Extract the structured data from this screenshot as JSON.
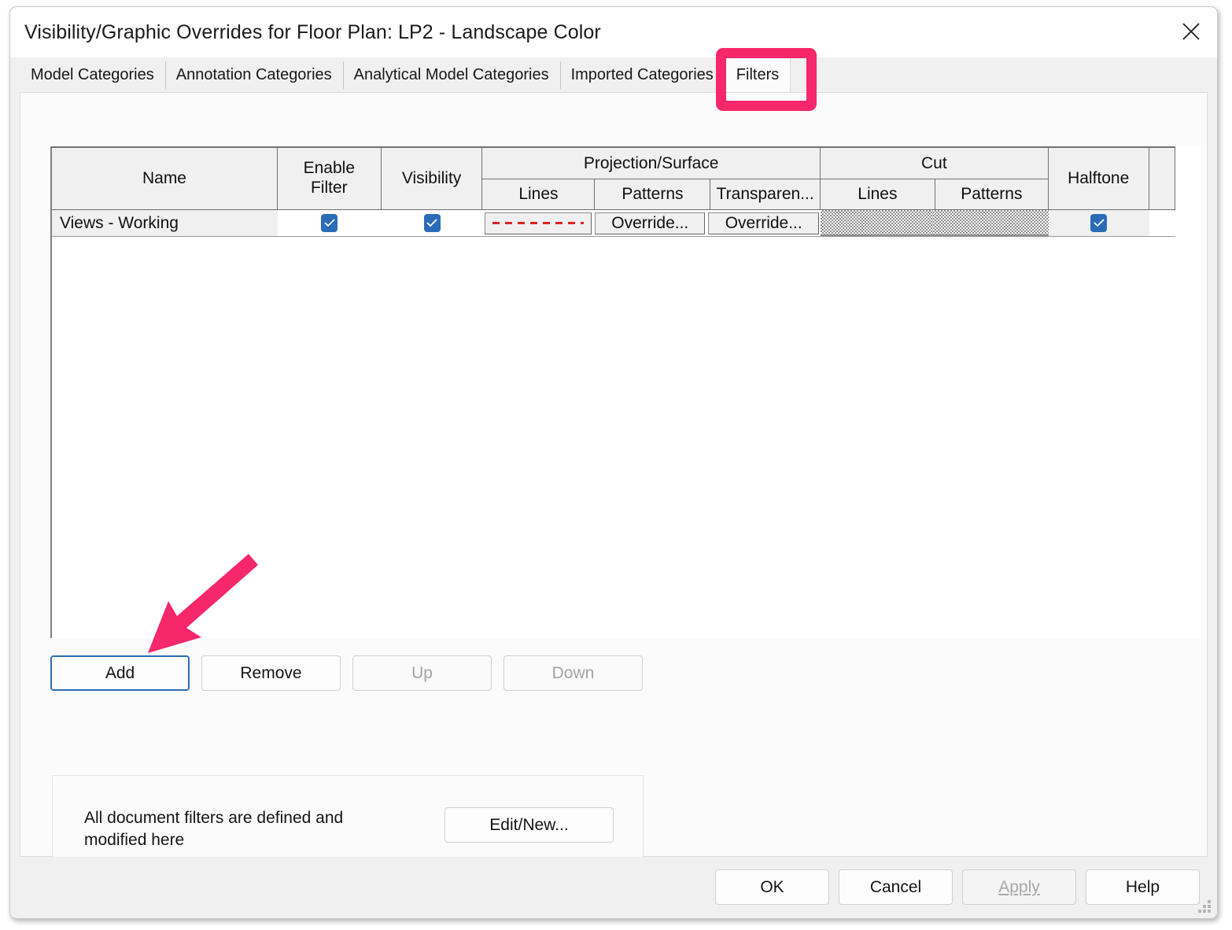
{
  "window": {
    "title": "Visibility/Graphic Overrides for Floor Plan: LP2 - Landscape Color",
    "close_icon": "close-icon"
  },
  "tabs": [
    {
      "label": "Model Categories",
      "selected": false
    },
    {
      "label": "Annotation Categories",
      "selected": false
    },
    {
      "label": "Analytical Model Categories",
      "selected": false
    },
    {
      "label": "Imported Categories",
      "selected": false
    },
    {
      "label": "Filters",
      "selected": true
    }
  ],
  "table": {
    "headers": {
      "name": "Name",
      "enable_filter_line1": "Enable",
      "enable_filter_line2": "Filter",
      "visibility": "Visibility",
      "projection_surface": "Projection/Surface",
      "projection_lines": "Lines",
      "projection_patterns": "Patterns",
      "projection_transparency": "Transparen...",
      "cut": "Cut",
      "cut_lines": "Lines",
      "cut_patterns": "Patterns",
      "halftone": "Halftone"
    },
    "rows": [
      {
        "name": "Views - Working",
        "enable_filter_checked": true,
        "visibility_checked": true,
        "projection_lines": "",
        "projection_lines_style": "red-dashed",
        "projection_patterns": "Override...",
        "projection_transparency": "Override...",
        "cut_lines": "",
        "cut_lines_disabled": true,
        "cut_patterns": "",
        "cut_patterns_disabled": true,
        "halftone_checked": true
      }
    ]
  },
  "list_buttons": [
    {
      "label": "Add",
      "enabled": true,
      "focused": true
    },
    {
      "label": "Remove",
      "enabled": true,
      "focused": false
    },
    {
      "label": "Up",
      "enabled": false,
      "focused": false
    },
    {
      "label": "Down",
      "enabled": false,
      "focused": false
    }
  ],
  "info_group": {
    "text": "All document filters are defined and modified here",
    "button_label": "Edit/New..."
  },
  "footer_buttons": [
    {
      "label": "OK",
      "enabled": true
    },
    {
      "label": "Cancel",
      "enabled": true
    },
    {
      "label": "Apply",
      "enabled": false,
      "accel": "A"
    },
    {
      "label": "Help",
      "enabled": true
    }
  ],
  "annotations": {
    "highlight_color": "#f7276b",
    "highlight_target": "Filters",
    "arrow_target": "Add"
  },
  "colors": {
    "accent_checkbox": "#2b6cb8",
    "annotation_pink": "#f7276b",
    "line_override_red": "#dd2222",
    "dialog_bg": "#f0f0f0",
    "panel_bg": "#fbfbfb"
  }
}
